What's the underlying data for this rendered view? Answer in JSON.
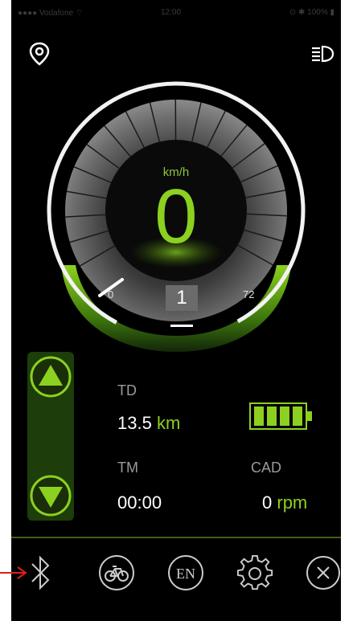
{
  "status_bar": {
    "carrier": "●●●●  Vodafone  ⌔",
    "time": "12:00",
    "right": "⊙ ✱ 100% ▮"
  },
  "header": {
    "left_icon": "location-pin-icon",
    "right_icon": "headlight-icon"
  },
  "speedometer": {
    "unit": "km/h",
    "speed": "0",
    "min_label": "0",
    "max_label": "72",
    "gauge_level": 0
  },
  "gear": {
    "value": "1"
  },
  "assist_controls": {
    "up_icon": "triangle-up-icon",
    "down_icon": "triangle-down-icon"
  },
  "stats": {
    "td_label": "TD",
    "td_value": "13.5",
    "td_unit": "km",
    "tm_label": "TM",
    "tm_value": "00:00",
    "cad_label": "CAD",
    "cad_value": "0",
    "cad_unit": "rpm",
    "battery_level": 1.0
  },
  "bottom_nav": [
    {
      "name": "bluetooth",
      "icon": "bluetooth-icon"
    },
    {
      "name": "bike",
      "icon": "bike-icon"
    },
    {
      "name": "language",
      "label": "EN"
    },
    {
      "name": "settings",
      "icon": "gear-icon"
    },
    {
      "name": "close",
      "icon": "close-icon"
    }
  ],
  "colors": {
    "accent": "#8cd11f",
    "background": "#000000",
    "pointer": "#e0201c"
  }
}
